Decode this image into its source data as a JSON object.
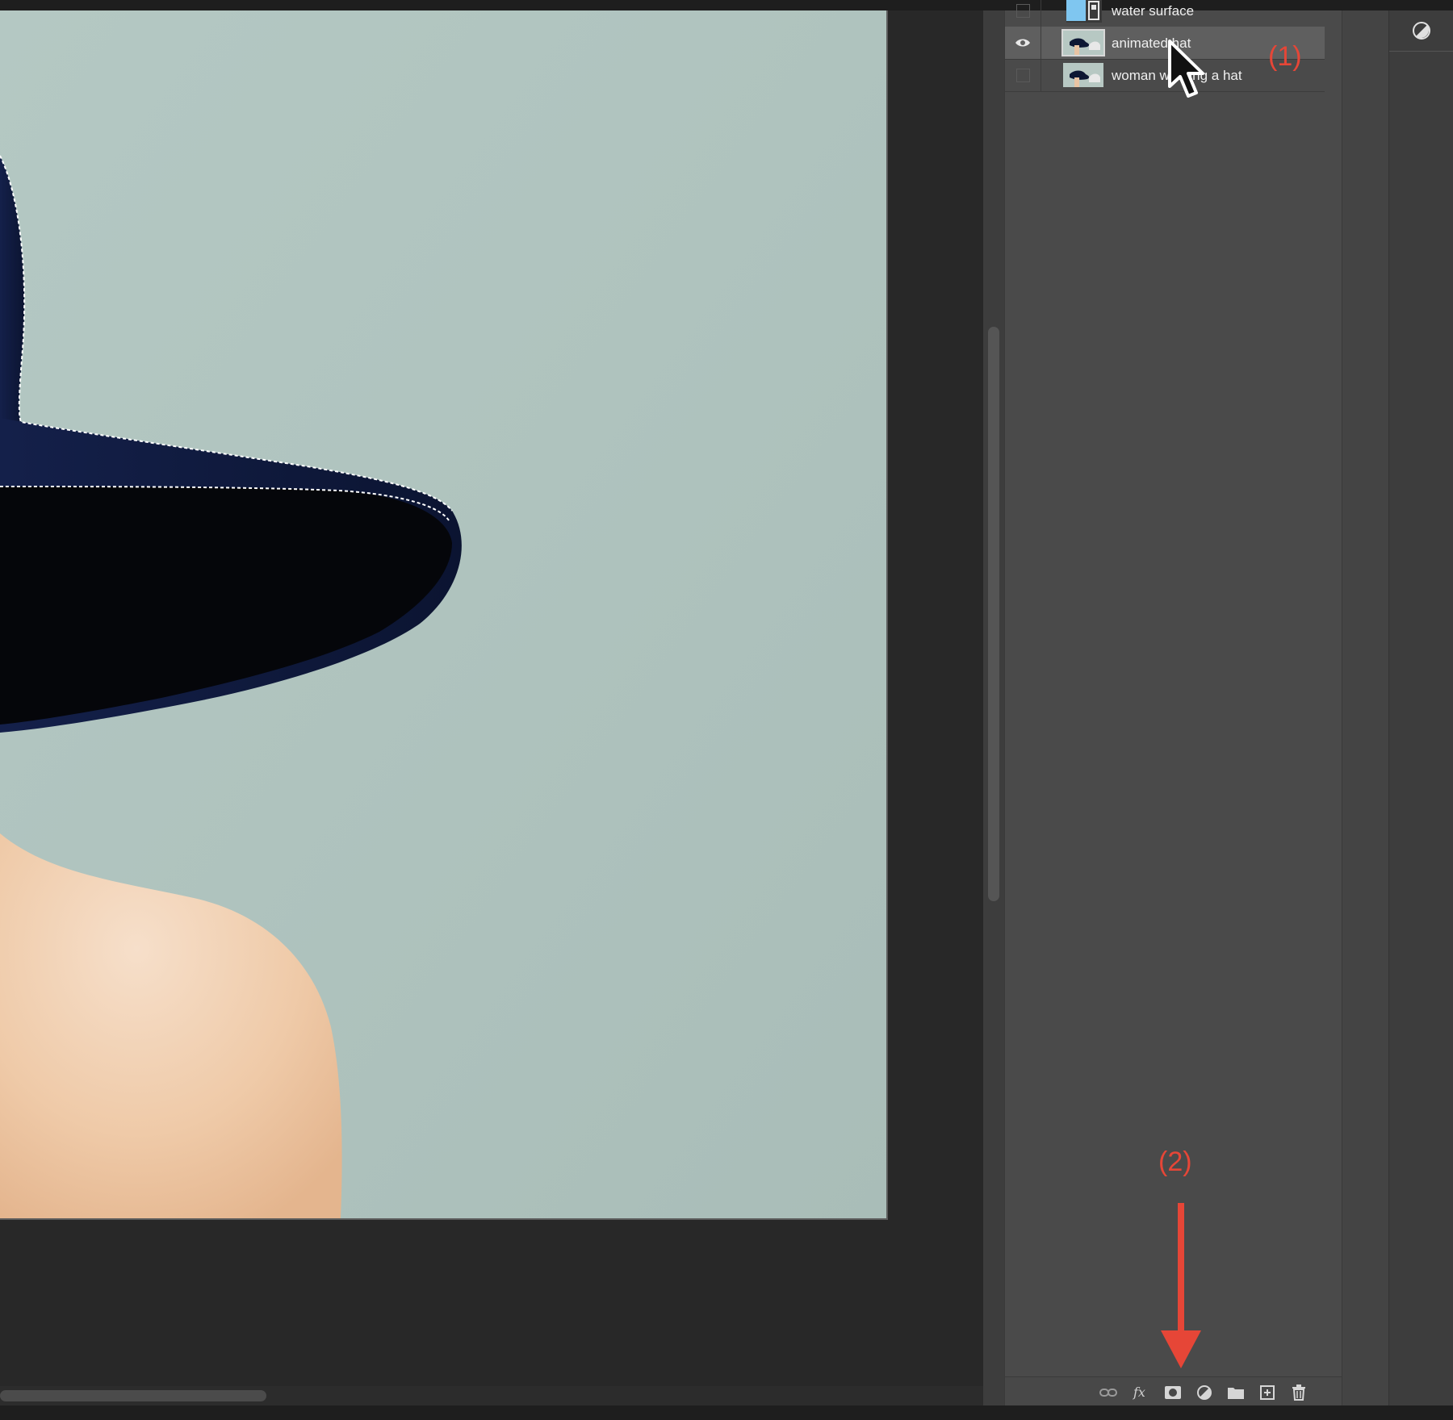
{
  "layers_panel": {
    "layers": [
      {
        "name": "water surface",
        "visible": false,
        "selected": false
      },
      {
        "name": "animated hat",
        "visible": true,
        "selected": true
      },
      {
        "name": "woman wearing a hat",
        "visible": false,
        "selected": false
      }
    ],
    "footer_icons": [
      "link-layers-icon",
      "fx-icon",
      "add-mask-icon",
      "adjustment-layer-icon",
      "new-group-icon",
      "new-layer-icon",
      "delete-layer-icon"
    ]
  },
  "annotations": {
    "step1": "(1)",
    "step2": "(2)"
  },
  "colors": {
    "annotation": "#e64637",
    "canvas_background": "#afc3be",
    "hat": "#0d1733",
    "skin": "#f2d2b6"
  }
}
